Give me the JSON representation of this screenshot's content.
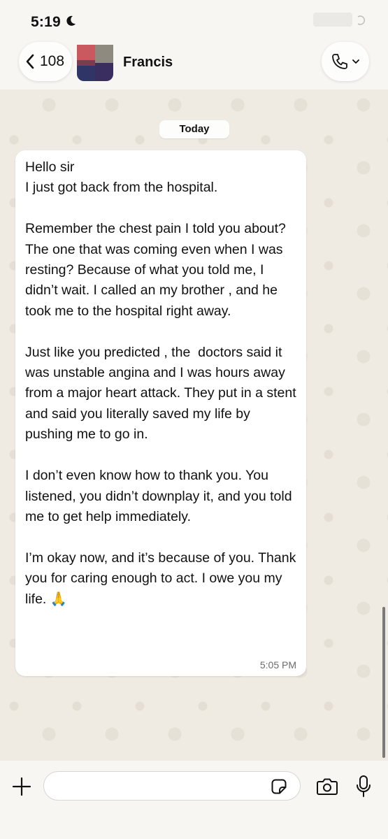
{
  "status_bar": {
    "time": "5:19"
  },
  "header": {
    "back_count": "108",
    "contact_name": "Francis"
  },
  "chat": {
    "date_label": "Today",
    "message": {
      "text": "Hello sir\nI just got back from the hospital.\n\nRemember the chest pain I told you about? The one that was coming even when I was resting? Because of what you told me, I didn’t wait. I called an my brother , and he took me to the hospital right away.\n\nJust like you predicted , the  doctors said it was unstable angina and I was hours away from a major heart attack. They put in a stent and said you literally saved my life by pushing me to go in.\n\nI don’t even know how to thank you. You listened, you didn’t downplay it, and you told me to get help immediately.\n\nI’m okay now, and it’s because of you. Thank you for caring enough to act. I owe you my life. 🙏",
      "time": "5:05 PM"
    }
  },
  "composer": {
    "value": "",
    "placeholder": ""
  },
  "colors": {
    "wallpaper": "#efeae2",
    "bubble": "#ffffff",
    "bar": "#f7f6f3"
  },
  "icons": [
    "moon-icon",
    "back-chevron-icon",
    "phone-icon",
    "chevron-down-icon",
    "plus-icon",
    "sticker-icon",
    "camera-icon",
    "microphone-icon"
  ]
}
